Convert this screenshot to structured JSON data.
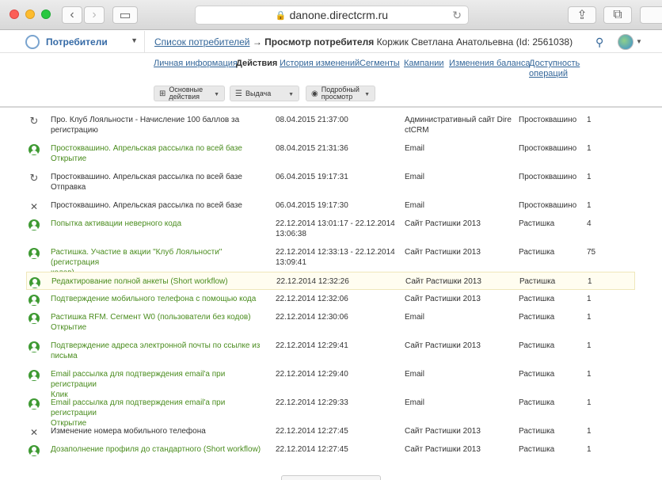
{
  "browser": {
    "url": "danone.directcrm.ru"
  },
  "header": {
    "brand": "Потребители",
    "breadcrumb_link": "Список потребителей",
    "breadcrumb_arrow": "→",
    "breadcrumb_current": "Просмотр потребителя",
    "breadcrumb_subject": "Коржик Светлана Анатольевна (Id: 2561038)"
  },
  "tabs": [
    {
      "label": "Личная информация",
      "active": false
    },
    {
      "label": "Действия",
      "active": true
    },
    {
      "label": "История изменений",
      "active": false
    },
    {
      "label": "Сегменты",
      "active": false
    },
    {
      "label": "Кампании",
      "active": false
    },
    {
      "label": "Изменения баланса",
      "active": false
    },
    {
      "label": "Доступность",
      "label2": "операций",
      "active": false
    }
  ],
  "toolbar": {
    "basic_actions_line1": "Основные",
    "basic_actions_line2": "действия",
    "output": "Выдача",
    "details_line1": "Подробный",
    "details_line2": "просмотр"
  },
  "rows": [
    {
      "icon": "redo-icon",
      "green": false,
      "name1": "Про. Клуб Лояльности - Начисление 100 баллов за",
      "name2": "регистрацию",
      "date1": "08.04.2015 21:37:00",
      "date2": "",
      "chan1": "Административный сайт Dire",
      "chan2": "ctCRM",
      "brand": "Простоквашино",
      "qty": "1"
    },
    {
      "icon": "person-icon",
      "green": true,
      "name1": "Простоквашино. Апрельская рассылка по всей базе",
      "name2": "Открытие",
      "date1": "08.04.2015 21:31:36",
      "date2": "",
      "chan1": "Email",
      "chan2": "",
      "brand": "Простоквашино",
      "qty": "1"
    },
    {
      "icon": "redo-icon",
      "green": false,
      "name1": "Простоквашино. Апрельская рассылка по всей базе",
      "name2": "Отправка",
      "date1": "06.04.2015 19:17:31",
      "date2": "",
      "chan1": "Email",
      "chan2": "",
      "brand": "Простоквашино",
      "qty": "1"
    },
    {
      "icon": "tools-icon",
      "green": false,
      "name1": "Простоквашино. Апрельская рассылка по всей базе",
      "name2": "",
      "date1": "06.04.2015 19:17:30",
      "date2": "",
      "chan1": "Email",
      "chan2": "",
      "brand": "Простоквашино",
      "qty": "1"
    },
    {
      "icon": "person-icon",
      "green": true,
      "name1": "Попытка активации неверного кода",
      "name2": "",
      "date1": "22.12.2014 13:01:17 - 22.12.2014",
      "date2": "13:06:38",
      "chan1": "Сайт Растишки 2013",
      "chan2": "",
      "brand": "Растишка",
      "qty": "4"
    },
    {
      "icon": "person-icon",
      "green": true,
      "name1": "Растишка. Участие в акции \"Клуб Лояльности\" (регистрация",
      "name2": "кодов)",
      "date1": "22.12.2014 12:33:13 - 22.12.2014",
      "date2": "13:09:41",
      "chan1": "Сайт Растишки 2013",
      "chan2": "",
      "brand": "Растишка",
      "qty": "75"
    },
    {
      "icon": "person-icon",
      "green": true,
      "highlight": true,
      "name1": "Редактирование полной анкеты (Short workflow)",
      "name2": "",
      "date1": "22.12.2014 12:32:26",
      "date2": "",
      "chan1": "Сайт Растишки 2013",
      "chan2": "",
      "brand": "Растишка",
      "qty": "1"
    },
    {
      "icon": "person-icon",
      "green": true,
      "name1": "Подтверждение мобильного телефона с помощью кода",
      "name2": "",
      "date1": "22.12.2014 12:32:06",
      "date2": "",
      "chan1": "Сайт Растишки 2013",
      "chan2": "",
      "brand": "Растишка",
      "qty": "1"
    },
    {
      "icon": "person-icon",
      "green": true,
      "name1": "Растишка RFM. Сегмент W0 (пользователи без кодов)",
      "name2": "Открытие",
      "date1": "22.12.2014 12:30:06",
      "date2": "",
      "chan1": "Email",
      "chan2": "",
      "brand": "Растишка",
      "qty": "1"
    },
    {
      "icon": "person-icon",
      "green": true,
      "name1": "Подтверждение адреса электронной почты по ссылке из",
      "name2": "письма",
      "date1": "22.12.2014 12:29:41",
      "date2": "",
      "chan1": "Сайт Растишки 2013",
      "chan2": "",
      "brand": "Растишка",
      "qty": "1"
    },
    {
      "icon": "person-icon",
      "green": true,
      "name1": "Email рассылка для подтверждения email'а при регистрации",
      "name2": "Клик",
      "date1": "22.12.2014 12:29:40",
      "date2": "",
      "chan1": "Email",
      "chan2": "",
      "brand": "Растишка",
      "qty": "1"
    },
    {
      "icon": "person-icon",
      "green": true,
      "name1": "Email рассылка для подтверждения email'а при регистрации",
      "name2": "Открытие",
      "date1": "22.12.2014 12:29:33",
      "date2": "",
      "chan1": "Email",
      "chan2": "",
      "brand": "Растишка",
      "qty": "1"
    },
    {
      "icon": "tools-icon",
      "green": false,
      "name1": "Изменение номера мобильного телефона",
      "name2": "",
      "date1": "22.12.2014 12:27:45",
      "date2": "",
      "chan1": "Сайт Растишки 2013",
      "chan2": "",
      "brand": "Растишка",
      "qty": "1"
    },
    {
      "icon": "person-icon",
      "green": true,
      "name1": "Дозаполнение профиля до стандартного (Short workflow)",
      "name2": "",
      "date1": "22.12.2014 12:27:45",
      "date2": "",
      "chan1": "Сайт Растишки 2013",
      "chan2": "",
      "brand": "Растишка",
      "qty": "1"
    }
  ]
}
